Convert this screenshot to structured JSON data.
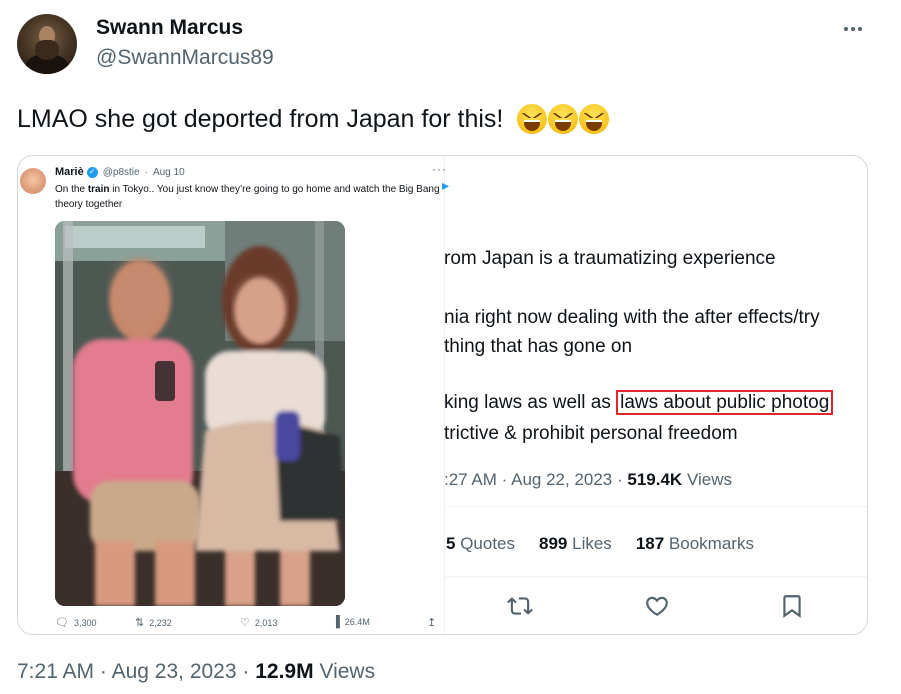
{
  "author": {
    "name": "Swann Marcus",
    "handle": "@SwannMarcus89"
  },
  "tweet": {
    "text": "LMAO she got deported from Japan for this!",
    "emojis": [
      "grinning-squinting-face",
      "grinning-squinting-face",
      "grinning-squinting-face"
    ],
    "time": "7:21 AM",
    "date": "Aug 23, 2023",
    "views_count": "12.9M",
    "views_label": "Views",
    "separator": "·"
  },
  "embedded": {
    "left_tweet": {
      "name": "Mariè",
      "handle": "@p8stie",
      "date": "Aug 10",
      "text_before": "On the ",
      "text_bold": "train",
      "text_after": " in Tokyo.. You just know they’re going to go home and watch the Big Bang theory together",
      "more": "···",
      "actions": {
        "replies": "3,300",
        "retweets": "2,232",
        "likes": "2,013",
        "views": "26.4M"
      }
    },
    "right_tweet": {
      "line1": "rom Japan is a traumatizing experience",
      "line2": "nia right now dealing with the after effects/try",
      "line3": "thing that has gone on",
      "line4_pre": "king laws as well as",
      "line4_highlight": "laws about public photog",
      "line5": "trictive & prohibit personal freedom",
      "time": ":27 AM",
      "date": "Aug 22, 2023",
      "views_count": "519.4K",
      "views_label": "Views",
      "quotes_count": "5",
      "quotes_label": "Quotes",
      "likes_count": "899",
      "likes_label": "Likes",
      "bookmarks_count": "187",
      "bookmarks_label": "Bookmarks"
    }
  },
  "colors": {
    "text": "#0f1419",
    "secondary": "#536471",
    "accent": "#1d9bf0",
    "highlight_box": "#e0252c",
    "border": "#cfd9de"
  }
}
